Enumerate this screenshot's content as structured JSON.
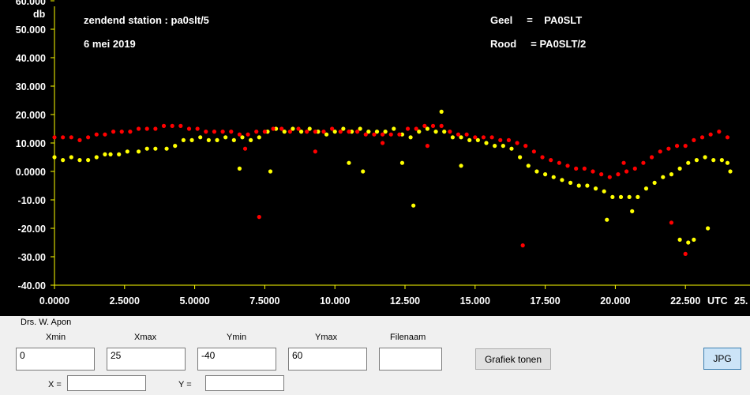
{
  "chart_data": {
    "type": "scatter",
    "title": "",
    "xlabel": "UTC",
    "ylabel": "db",
    "xlim": [
      0,
      25
    ],
    "ylim": [
      -40,
      60
    ],
    "x_ticks": [
      "0.0000",
      "2.5000",
      "5.0000",
      "7.5000",
      "10.000",
      "12.500",
      "15.000",
      "17.500",
      "20.000",
      "22.500",
      "25."
    ],
    "y_ticks": [
      "60.000",
      "50.000",
      "40.000",
      "30.000",
      "20.000",
      "10.000",
      "0.0000",
      "-10.00",
      "-20.00",
      "-30.00",
      "-40.00"
    ],
    "grid": false,
    "annotations": {
      "station": "zendend station :  pa0slt/5",
      "date": "6 mei 2019",
      "legend_geel": "Geel     =    PA0SLT",
      "legend_rood": "Rood     = PA0SLT/2"
    },
    "series": [
      {
        "name": "PA0SLT",
        "color": "#ffff00",
        "points": [
          [
            0.0,
            5
          ],
          [
            0.3,
            4
          ],
          [
            0.6,
            5
          ],
          [
            0.9,
            4
          ],
          [
            1.2,
            4
          ],
          [
            1.5,
            5
          ],
          [
            1.8,
            6
          ],
          [
            2.0,
            6
          ],
          [
            2.3,
            6
          ],
          [
            2.6,
            7
          ],
          [
            3.0,
            7
          ],
          [
            3.3,
            8
          ],
          [
            3.6,
            8
          ],
          [
            4.0,
            8
          ],
          [
            4.3,
            9
          ],
          [
            4.6,
            11
          ],
          [
            4.9,
            11
          ],
          [
            5.2,
            12
          ],
          [
            5.5,
            11
          ],
          [
            5.8,
            11
          ],
          [
            6.1,
            12
          ],
          [
            6.4,
            11
          ],
          [
            6.7,
            12
          ],
          [
            7.0,
            11
          ],
          [
            7.3,
            12
          ],
          [
            7.6,
            14
          ],
          [
            7.9,
            15
          ],
          [
            8.2,
            14
          ],
          [
            8.5,
            15
          ],
          [
            8.8,
            14
          ],
          [
            9.1,
            15
          ],
          [
            9.4,
            14
          ],
          [
            9.7,
            13
          ],
          [
            10.0,
            14
          ],
          [
            10.3,
            15
          ],
          [
            10.6,
            14
          ],
          [
            10.9,
            15
          ],
          [
            11.2,
            14
          ],
          [
            11.5,
            14
          ],
          [
            11.8,
            14
          ],
          [
            12.1,
            15
          ],
          [
            12.4,
            13
          ],
          [
            12.7,
            12
          ],
          [
            13.0,
            14
          ],
          [
            13.3,
            15
          ],
          [
            13.6,
            14
          ],
          [
            13.9,
            14
          ],
          [
            14.2,
            12
          ],
          [
            14.5,
            12
          ],
          [
            14.8,
            11
          ],
          [
            15.1,
            11
          ],
          [
            15.4,
            10
          ],
          [
            15.7,
            9
          ],
          [
            16.0,
            9
          ],
          [
            16.3,
            8
          ],
          [
            16.6,
            5
          ],
          [
            16.9,
            2
          ],
          [
            17.2,
            0
          ],
          [
            17.5,
            -1
          ],
          [
            17.8,
            -2
          ],
          [
            18.1,
            -3
          ],
          [
            18.4,
            -4
          ],
          [
            18.7,
            -5
          ],
          [
            19.0,
            -5
          ],
          [
            19.3,
            -6
          ],
          [
            19.6,
            -7
          ],
          [
            19.9,
            -9
          ],
          [
            20.2,
            -9
          ],
          [
            20.5,
            -9
          ],
          [
            20.8,
            -9
          ],
          [
            21.1,
            -6
          ],
          [
            21.4,
            -4
          ],
          [
            21.7,
            -2
          ],
          [
            22.0,
            -1
          ],
          [
            22.3,
            1
          ],
          [
            22.6,
            3
          ],
          [
            22.9,
            4
          ],
          [
            23.2,
            5
          ],
          [
            23.5,
            4
          ],
          [
            23.8,
            4
          ],
          [
            24.0,
            3
          ],
          [
            12.8,
            -12
          ],
          [
            13.8,
            21
          ],
          [
            19.7,
            -17
          ],
          [
            20.6,
            -14
          ],
          [
            22.3,
            -24
          ],
          [
            22.6,
            -25
          ],
          [
            22.8,
            -24
          ],
          [
            23.3,
            -20
          ],
          [
            6.6,
            1
          ],
          [
            7.7,
            0
          ],
          [
            11.0,
            0
          ],
          [
            10.5,
            3
          ],
          [
            12.4,
            3
          ],
          [
            14.5,
            2
          ],
          [
            24.1,
            0
          ]
        ]
      },
      {
        "name": "PA0SLT/2",
        "color": "#ff0000",
        "points": [
          [
            0.0,
            12
          ],
          [
            0.3,
            12
          ],
          [
            0.6,
            12
          ],
          [
            0.9,
            11
          ],
          [
            1.2,
            12
          ],
          [
            1.5,
            13
          ],
          [
            1.8,
            13
          ],
          [
            2.1,
            14
          ],
          [
            2.4,
            14
          ],
          [
            2.7,
            14
          ],
          [
            3.0,
            15
          ],
          [
            3.3,
            15
          ],
          [
            3.6,
            15
          ],
          [
            3.9,
            16
          ],
          [
            4.2,
            16
          ],
          [
            4.5,
            16
          ],
          [
            4.8,
            15
          ],
          [
            5.1,
            15
          ],
          [
            5.4,
            14
          ],
          [
            5.7,
            14
          ],
          [
            6.0,
            14
          ],
          [
            6.3,
            14
          ],
          [
            6.6,
            13
          ],
          [
            6.9,
            13
          ],
          [
            7.2,
            14
          ],
          [
            7.5,
            14
          ],
          [
            7.8,
            15
          ],
          [
            8.1,
            15
          ],
          [
            8.4,
            14
          ],
          [
            8.7,
            15
          ],
          [
            9.0,
            14
          ],
          [
            9.3,
            14
          ],
          [
            9.6,
            14
          ],
          [
            9.9,
            15
          ],
          [
            10.2,
            14
          ],
          [
            10.5,
            14
          ],
          [
            10.8,
            14
          ],
          [
            11.1,
            13
          ],
          [
            11.4,
            13
          ],
          [
            11.7,
            13
          ],
          [
            12.0,
            13
          ],
          [
            12.3,
            13
          ],
          [
            12.6,
            15
          ],
          [
            12.9,
            15
          ],
          [
            13.2,
            16
          ],
          [
            13.5,
            16
          ],
          [
            13.8,
            16
          ],
          [
            14.1,
            14
          ],
          [
            14.4,
            13
          ],
          [
            14.7,
            13
          ],
          [
            15.0,
            12
          ],
          [
            15.3,
            12
          ],
          [
            15.6,
            12
          ],
          [
            15.9,
            11
          ],
          [
            16.2,
            11
          ],
          [
            16.5,
            10
          ],
          [
            16.8,
            9
          ],
          [
            17.1,
            7
          ],
          [
            17.4,
            5
          ],
          [
            17.7,
            4
          ],
          [
            18.0,
            3
          ],
          [
            18.3,
            2
          ],
          [
            18.6,
            1
          ],
          [
            18.9,
            1
          ],
          [
            19.2,
            0
          ],
          [
            19.5,
            -1
          ],
          [
            19.8,
            -2
          ],
          [
            20.1,
            -1
          ],
          [
            20.4,
            0
          ],
          [
            20.7,
            1
          ],
          [
            21.0,
            3
          ],
          [
            21.3,
            5
          ],
          [
            21.6,
            7
          ],
          [
            21.9,
            8
          ],
          [
            22.2,
            9
          ],
          [
            22.5,
            9
          ],
          [
            22.8,
            11
          ],
          [
            23.1,
            12
          ],
          [
            23.4,
            13
          ],
          [
            23.7,
            14
          ],
          [
            24.0,
            12
          ],
          [
            7.3,
            -16
          ],
          [
            16.7,
            -26
          ],
          [
            22.0,
            -18
          ],
          [
            22.5,
            -29
          ],
          [
            20.3,
            3
          ],
          [
            9.3,
            7
          ],
          [
            11.7,
            10
          ],
          [
            6.8,
            8
          ],
          [
            13.3,
            9
          ]
        ]
      }
    ]
  },
  "panel": {
    "author": "Drs. W. Apon",
    "xmin_label": "Xmin",
    "xmin_value": "0",
    "xmax_label": "Xmax",
    "xmax_value": "25",
    "ymin_label": "Ymin",
    "ymin_value": "-40",
    "ymax_label": "Ymax",
    "ymax_value": "60",
    "filenaam_label": "Filenaam",
    "filenaam_value": "",
    "grafiek_button": "Grafiek tonen",
    "jpg_button": "JPG",
    "x_label": "X =",
    "x_value": "",
    "y_label": "Y =",
    "y_value": ""
  }
}
